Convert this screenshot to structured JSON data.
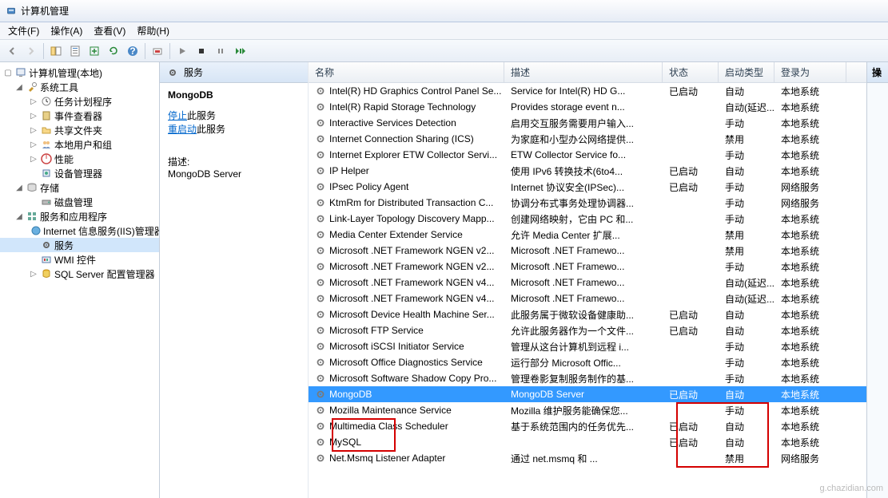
{
  "window": {
    "title": "计算机管理"
  },
  "menu": {
    "file": "文件(F)",
    "action": "操作(A)",
    "view": "查看(V)",
    "help": "帮助(H)"
  },
  "tree": {
    "root": "计算机管理(本地)",
    "sys_tools": "系统工具",
    "task_sched": "任务计划程序",
    "event_viewer": "事件查看器",
    "shared": "共享文件夹",
    "users": "本地用户和组",
    "perf": "性能",
    "devmgr": "设备管理器",
    "storage": "存储",
    "diskmgr": "磁盘管理",
    "apps": "服务和应用程序",
    "iis": "Internet 信息服务(IIS)管理器",
    "services": "服务",
    "wmi": "WMI 控件",
    "sql": "SQL Server 配置管理器"
  },
  "center": {
    "header": "服务",
    "selected_name": "MongoDB",
    "stop_link": "停止",
    "stop_suffix": "此服务",
    "restart_link": "重启动",
    "restart_suffix": "此服务",
    "desc_label": "描述:",
    "desc_value": "MongoDB Server"
  },
  "columns": {
    "name": "名称",
    "desc": "描述",
    "status": "状态",
    "startup": "启动类型",
    "logon": "登录为"
  },
  "right": {
    "header": "操"
  },
  "watermark": "g.chazidian.com",
  "services": [
    {
      "name": "Intel(R) HD Graphics Control Panel Se...",
      "desc": "Service for Intel(R) HD G...",
      "status": "已启动",
      "startup": "自动",
      "logon": "本地系统"
    },
    {
      "name": "Intel(R) Rapid Storage Technology",
      "desc": "Provides storage event n...",
      "status": "",
      "startup": "自动(延迟...",
      "logon": "本地系统"
    },
    {
      "name": "Interactive Services Detection",
      "desc": "启用交互服务需要用户输入...",
      "status": "",
      "startup": "手动",
      "logon": "本地系统"
    },
    {
      "name": "Internet Connection Sharing (ICS)",
      "desc": "为家庭和小型办公网络提供...",
      "status": "",
      "startup": "禁用",
      "logon": "本地系统"
    },
    {
      "name": "Internet Explorer ETW Collector Servi...",
      "desc": "ETW Collector Service fo...",
      "status": "",
      "startup": "手动",
      "logon": "本地系统"
    },
    {
      "name": "IP Helper",
      "desc": "使用 IPv6 转换技术(6to4...",
      "status": "已启动",
      "startup": "自动",
      "logon": "本地系统"
    },
    {
      "name": "IPsec Policy Agent",
      "desc": "Internet 协议安全(IPSec)...",
      "status": "已启动",
      "startup": "手动",
      "logon": "网络服务"
    },
    {
      "name": "KtmRm for Distributed Transaction C...",
      "desc": "协调分布式事务处理协调器...",
      "status": "",
      "startup": "手动",
      "logon": "网络服务"
    },
    {
      "name": "Link-Layer Topology Discovery Mapp...",
      "desc": "创建网络映射，它由 PC 和...",
      "status": "",
      "startup": "手动",
      "logon": "本地系统"
    },
    {
      "name": "Media Center Extender Service",
      "desc": "允许 Media Center 扩展...",
      "status": "",
      "startup": "禁用",
      "logon": "本地系统"
    },
    {
      "name": "Microsoft .NET Framework NGEN v2...",
      "desc": "Microsoft .NET Framewo...",
      "status": "",
      "startup": "禁用",
      "logon": "本地系统"
    },
    {
      "name": "Microsoft .NET Framework NGEN v2...",
      "desc": "Microsoft .NET Framewo...",
      "status": "",
      "startup": "手动",
      "logon": "本地系统"
    },
    {
      "name": "Microsoft .NET Framework NGEN v4...",
      "desc": "Microsoft .NET Framewo...",
      "status": "",
      "startup": "自动(延迟...",
      "logon": "本地系统"
    },
    {
      "name": "Microsoft .NET Framework NGEN v4...",
      "desc": "Microsoft .NET Framewo...",
      "status": "",
      "startup": "自动(延迟...",
      "logon": "本地系统"
    },
    {
      "name": "Microsoft Device Health Machine Ser...",
      "desc": "此服务属于微软设备健康助...",
      "status": "已启动",
      "startup": "自动",
      "logon": "本地系统"
    },
    {
      "name": "Microsoft FTP Service",
      "desc": "允许此服务器作为一个文件...",
      "status": "已启动",
      "startup": "自动",
      "logon": "本地系统"
    },
    {
      "name": "Microsoft iSCSI Initiator Service",
      "desc": "管理从这台计算机到远程 i...",
      "status": "",
      "startup": "手动",
      "logon": "本地系统"
    },
    {
      "name": "Microsoft Office Diagnostics Service",
      "desc": "运行部分 Microsoft Offic...",
      "status": "",
      "startup": "手动",
      "logon": "本地系统"
    },
    {
      "name": "Microsoft Software Shadow Copy Pro...",
      "desc": "管理卷影复制服务制作的基...",
      "status": "",
      "startup": "手动",
      "logon": "本地系统"
    },
    {
      "name": "MongoDB",
      "desc": "MongoDB Server",
      "status": "已启动",
      "startup": "自动",
      "logon": "本地系统",
      "selected": true
    },
    {
      "name": "Mozilla Maintenance Service",
      "desc": "Mozilla 维护服务能确保您...",
      "status": "",
      "startup": "手动",
      "logon": "本地系统"
    },
    {
      "name": "Multimedia Class Scheduler",
      "desc": "基于系统范围内的任务优先...",
      "status": "已启动",
      "startup": "自动",
      "logon": "本地系统"
    },
    {
      "name": "MySQL",
      "desc": "",
      "status": "已启动",
      "startup": "自动",
      "logon": "本地系统"
    },
    {
      "name": "Net.Msmq Listener Adapter",
      "desc": "通过 net.msmq 和 ...",
      "status": "",
      "startup": "禁用",
      "logon": "网络服务"
    }
  ]
}
